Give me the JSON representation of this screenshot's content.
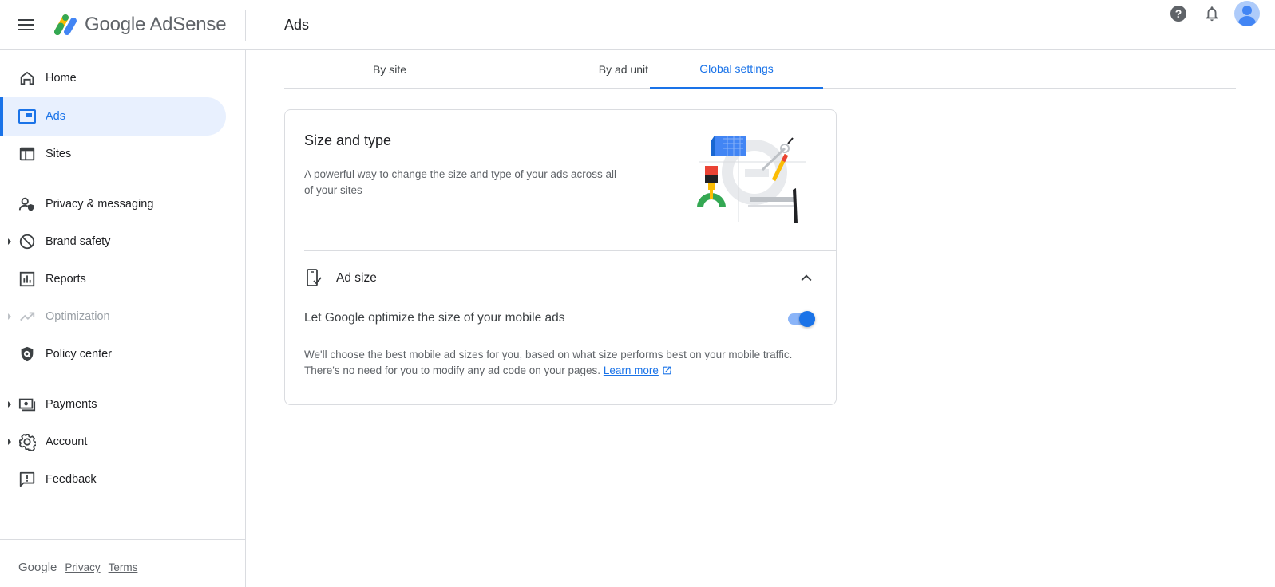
{
  "header": {
    "logo_text": "Google AdSense",
    "page_title": "Ads"
  },
  "sidebar": {
    "items": [
      {
        "label": "Home",
        "icon": "home-icon"
      },
      {
        "label": "Ads",
        "icon": "ads-icon",
        "active": true
      },
      {
        "label": "Sites",
        "icon": "sites-icon"
      },
      {
        "label": "Privacy & messaging",
        "icon": "privacy-icon"
      },
      {
        "label": "Brand safety",
        "icon": "block-icon",
        "expandable": true
      },
      {
        "label": "Reports",
        "icon": "reports-icon"
      },
      {
        "label": "Optimization",
        "icon": "trending-icon",
        "expandable": true,
        "disabled": true
      },
      {
        "label": "Policy center",
        "icon": "policy-icon"
      },
      {
        "label": "Payments",
        "icon": "payments-icon",
        "expandable": true
      },
      {
        "label": "Account",
        "icon": "gear-icon",
        "expandable": true
      },
      {
        "label": "Feedback",
        "icon": "feedback-icon"
      }
    ],
    "footer": {
      "brand": "Google",
      "privacy": "Privacy",
      "terms": "Terms"
    }
  },
  "tabs": [
    {
      "label": "By site"
    },
    {
      "label": "By ad unit"
    },
    {
      "label": "Global settings",
      "active": true
    }
  ],
  "card": {
    "title": "Size and type",
    "description": "A powerful way to change the size and type of your ads across all of your sites",
    "section": {
      "label": "Ad size",
      "expanded": true,
      "option_label": "Let Google optimize the size of your mobile ads",
      "option_enabled": true,
      "option_description": "We'll choose the best mobile ad sizes for you, based on what size performs best on your mobile traffic. There's no need for you to modify any ad code on your pages.",
      "learn_more": "Learn more"
    }
  },
  "colors": {
    "accent": "#1a73e8",
    "active_bg": "#e8f0fe",
    "toggle_track": "#8ab4f8"
  }
}
